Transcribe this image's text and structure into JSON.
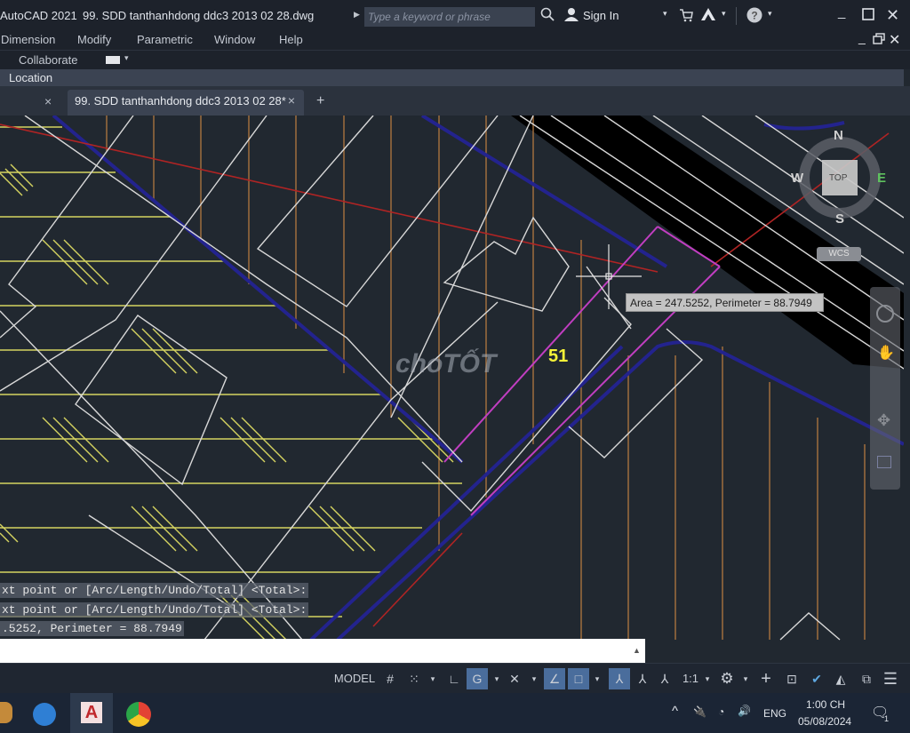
{
  "titlebar": {
    "app_name": "AutoCAD 2021",
    "file_name": "99. SDD tanthanhdong ddc3 2013 02 28.dwg",
    "search_placeholder": "Type a keyword or phrase",
    "sign_in_label": "Sign In",
    "icons": [
      "search-icon",
      "user-icon",
      "cart-icon",
      "autodesk-a360-icon",
      "help-icon",
      "minimize-icon",
      "maximize-icon",
      "close-icon"
    ]
  },
  "menubar": {
    "items": [
      "Dimension",
      "Modify",
      "Parametric",
      "Window",
      "Help"
    ]
  },
  "ribbon": {
    "tab_label": "Collaborate"
  },
  "location_bar": {
    "label": "Location"
  },
  "document_tabs": {
    "active_tab": "99. SDD tanthanhdong ddc3 2013 02 28*",
    "close_glyph": "×",
    "new_tab_glyph": "+"
  },
  "drawing": {
    "parcel_label": "51",
    "tooltip": "Area = 247.5252, Perimeter = 88.7949",
    "watermark": "choTỐT",
    "colors": {
      "background": "#212830",
      "white_lines": "#d8d8d8",
      "yellow_lines": "#d9d96a",
      "orange_lines": "#b07a4a",
      "blue_lines": "#22228a",
      "red_lines": "#b02020",
      "magenta_lines": "#c040c0",
      "road_fill": "#000000"
    }
  },
  "viewcube": {
    "north": "N",
    "south": "S",
    "east": "E",
    "west": "W",
    "face": "TOP",
    "ucs_label": "WCS"
  },
  "command_line": {
    "history": [
      "xt point or [Arc/Length/Undo/Total] <Total>:",
      "xt point or [Arc/Length/Undo/Total] <Total>:",
      ".5252, Perimeter = 88.7949"
    ],
    "input_value": ""
  },
  "statusbar": {
    "model_label": "MODEL",
    "scale_label": "1:1",
    "toggles": [
      "grid",
      "snap",
      "ortho",
      "polar",
      "isodraft",
      "osnap-tracking",
      "osnap",
      "annotation-visibility",
      "auto-scale",
      "annotation-scale",
      "workspace",
      "annotation-monitor",
      "units",
      "quick-properties",
      "lock-ui",
      "isolate",
      "hardware-acceleration",
      "clean-screen",
      "customization"
    ],
    "active_toggles": [
      "polar",
      "osnap-tracking",
      "osnap",
      "annotation-visibility"
    ]
  },
  "taskbar": {
    "apps": [
      "app-icon",
      "remote-desktop-icon",
      "autocad-icon",
      "chrome-icon"
    ],
    "language": "ENG",
    "time": "1:00 CH",
    "date": "05/08/2024",
    "notification_count": "1"
  }
}
